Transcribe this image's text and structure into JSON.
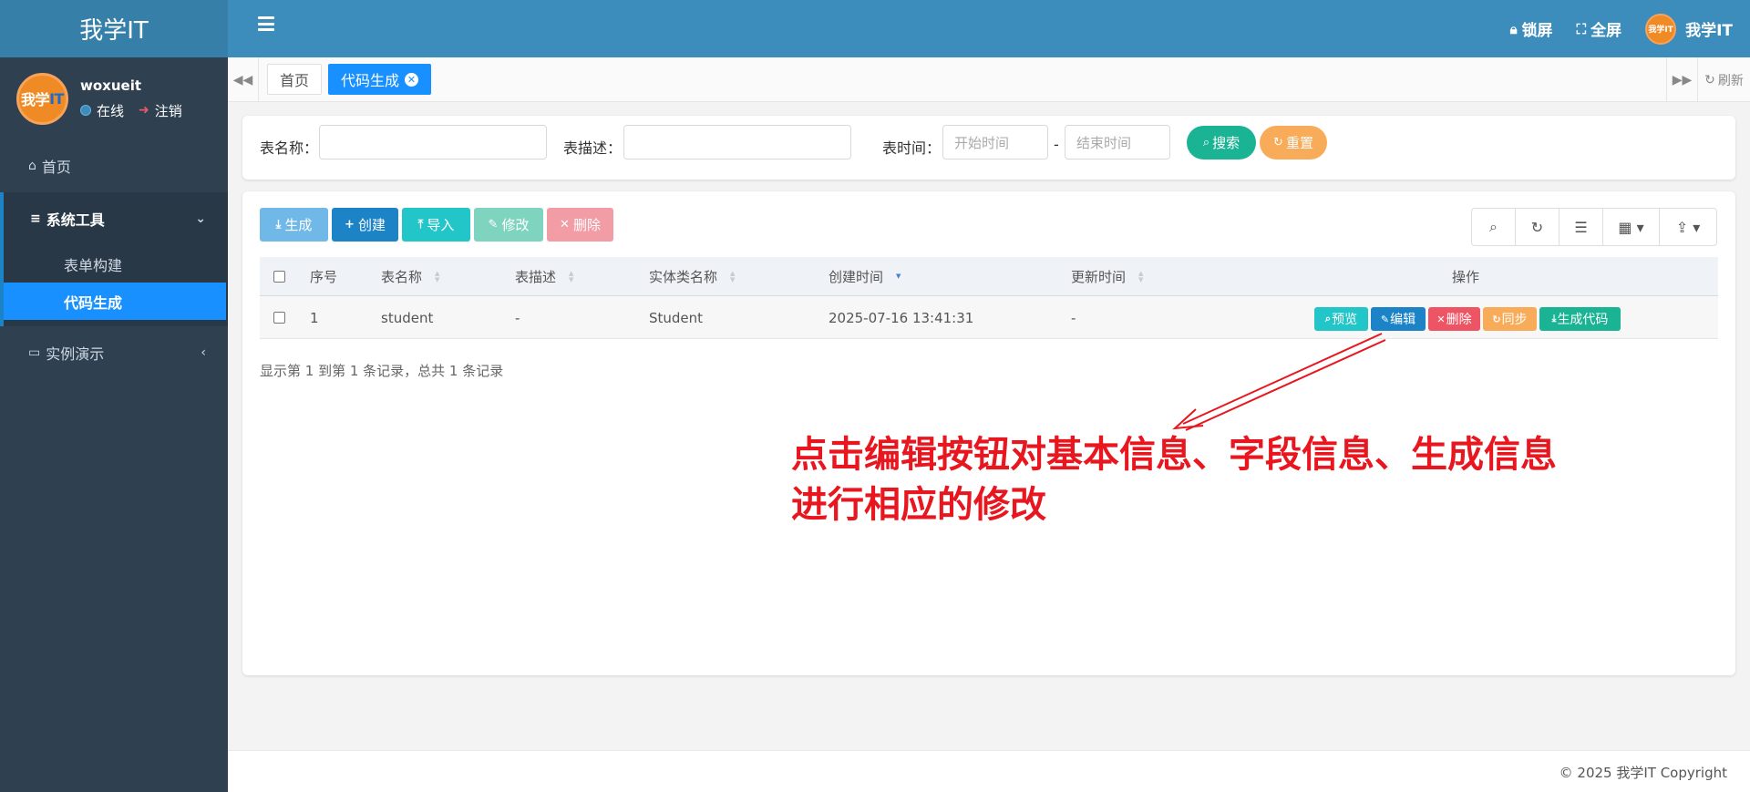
{
  "app": {
    "brand": "我学IT",
    "user": {
      "name": "woxueit",
      "status": "在线",
      "logout": "注销",
      "avatar_text": "我学",
      "avatar_it": "IT"
    }
  },
  "sidebar": {
    "home": "首页",
    "tools_group": "系统工具",
    "tools_items": [
      "表单构建",
      "代码生成"
    ],
    "demo": "实例演示"
  },
  "topbar": {
    "lock": "锁屏",
    "fullscreen": "全屏",
    "user_name": "我学IT",
    "avatar_text": "我学IT"
  },
  "tabs": {
    "items": [
      "首页",
      "代码生成"
    ],
    "refresh": "刷新"
  },
  "search": {
    "table_name_label": "表名称：",
    "table_desc_label": "表描述：",
    "table_time_label": "表时间：",
    "start_placeholder": "开始时间",
    "end_placeholder": "结束时间",
    "dash": "-",
    "search_button": "搜索",
    "reset_button": "重置"
  },
  "toolbar": {
    "generate": "生成",
    "create": "创建",
    "import": "导入",
    "edit": "修改",
    "delete": "删除"
  },
  "table": {
    "columns": [
      "序号",
      "表名称",
      "表描述",
      "实体类名称",
      "创建时间",
      "更新时间",
      "操作"
    ],
    "rows": [
      {
        "index": "1",
        "table_name": "student",
        "table_desc": "-",
        "class_name": "Student",
        "created": "2025-07-16 13:41:31",
        "updated": "-"
      }
    ],
    "row_actions": [
      "预览",
      "编辑",
      "删除",
      "同步",
      "生成代码"
    ],
    "pagination": "显示第 1 到第 1 条记录，总共 1 条记录"
  },
  "annotation": {
    "line1": "点击编辑按钮对基本信息、字段信息、生成信息",
    "line2": "进行相应的修改"
  },
  "footer": {
    "copyright": "© 2025 我学IT Copyright"
  },
  "colors": {
    "sidebar_bg": "#2f4050",
    "topbar_bg": "#3c8dbc",
    "brand_bg": "#367fa9",
    "active_blue": "#1890ff",
    "search_green": "#1ab394",
    "reset_orange": "#f8ac59",
    "annotation_red": "#e8161f"
  },
  "icons": {
    "home": "home-icon",
    "menu": "bars-icon",
    "lock": "lock-icon",
    "fullscreen": "expand-icon",
    "search": "search-icon",
    "refresh": "refresh-icon",
    "columns": "list-icon",
    "grid": "grid-icon",
    "export": "export-icon"
  }
}
